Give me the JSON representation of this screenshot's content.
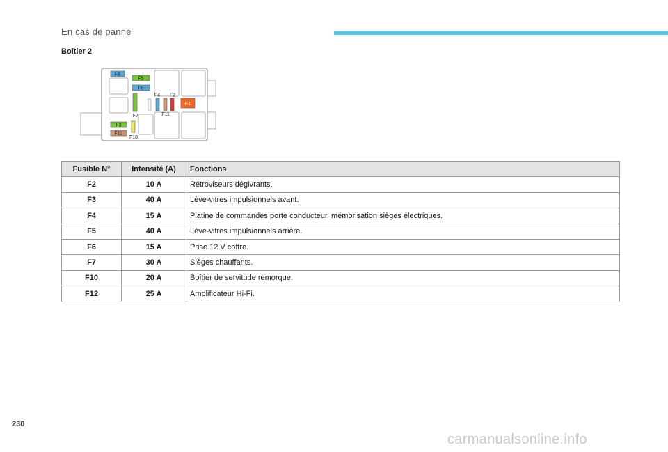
{
  "header": {
    "section": "En cas de panne",
    "accent_color": "#5ec4de"
  },
  "section_title": "Boîtier 2",
  "diagram": {
    "labels": {
      "f8": "F8",
      "f5": "F5",
      "f6": "F6",
      "f4": "F4",
      "f2": "F2",
      "f1": "F1",
      "f7": "F7",
      "f11": "F11",
      "f3": "F3",
      "f12": "F12",
      "f10": "F10"
    },
    "colors": {
      "f8": "#5aa9d6",
      "f5": "#7dc242",
      "f6": "#5aa9d6",
      "f4": "#5aa9d6",
      "f2": "#e03a3a",
      "f1": "#f26522",
      "f7": "#7dc242",
      "f11": "#c99a78",
      "f3": "#7dc242",
      "f12": "#c99a78",
      "f10": "#f4ea5a"
    }
  },
  "table": {
    "headers": {
      "fuse": "Fusible N°",
      "amp": "Intensité (A)",
      "func": "Fonctions"
    },
    "rows": [
      {
        "fuse": "F2",
        "amp": "10 A",
        "func": "Rétroviseurs dégivrants."
      },
      {
        "fuse": "F3",
        "amp": "40 A",
        "func": "Lève-vitres impulsionnels avant."
      },
      {
        "fuse": "F4",
        "amp": "15 A",
        "func": "Platine de commandes porte conducteur, mémorisation sièges électriques."
      },
      {
        "fuse": "F5",
        "amp": "40 A",
        "func": "Lève-vitres impulsionnels arrière."
      },
      {
        "fuse": "F6",
        "amp": "15 A",
        "func": "Prise 12 V coffre."
      },
      {
        "fuse": "F7",
        "amp": "30 A",
        "func": "Sièges chauffants."
      },
      {
        "fuse": "F10",
        "amp": "20 A",
        "func": "Boîtier de servitude remorque."
      },
      {
        "fuse": "F12",
        "amp": "25 A",
        "func": "Amplificateur Hi-Fi."
      }
    ]
  },
  "page_number": "230",
  "watermark": "carmanualsonline.info"
}
